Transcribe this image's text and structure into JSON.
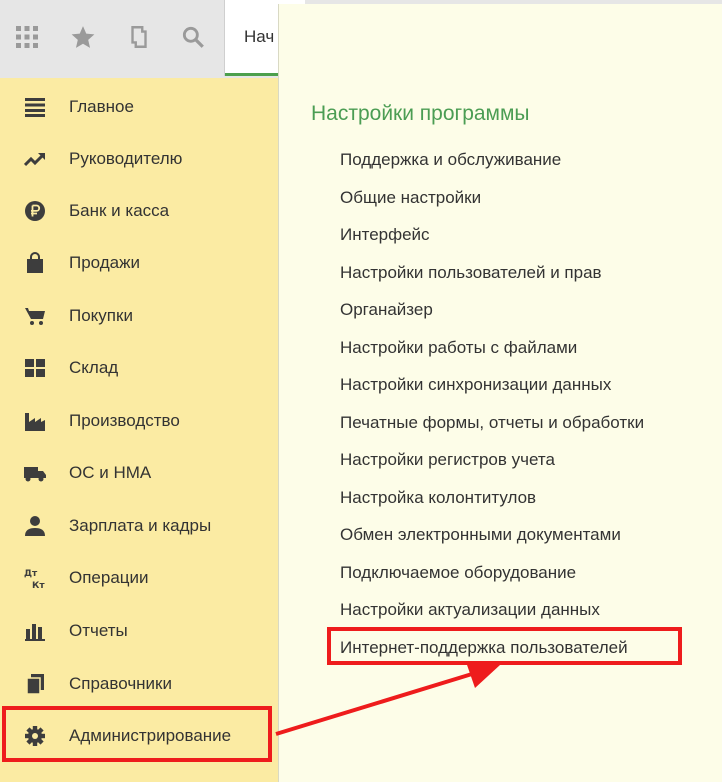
{
  "toolbar": {
    "icons": [
      "apps-grid-icon",
      "star-icon",
      "history-icon",
      "search-icon"
    ],
    "tab_label": "Нач"
  },
  "sidebar": {
    "items": [
      {
        "label": "Главное",
        "icon": "menu-lines-icon"
      },
      {
        "label": "Руководителю",
        "icon": "trend-icon"
      },
      {
        "label": "Банк и касса",
        "icon": "ruble-coin-icon"
      },
      {
        "label": "Продажи",
        "icon": "shopping-bag-icon"
      },
      {
        "label": "Покупки",
        "icon": "cart-icon"
      },
      {
        "label": "Склад",
        "icon": "warehouse-icon"
      },
      {
        "label": "Производство",
        "icon": "factory-icon"
      },
      {
        "label": "ОС и НМА",
        "icon": "truck-icon"
      },
      {
        "label": "Зарплата и кадры",
        "icon": "person-icon"
      },
      {
        "label": "Операции",
        "icon": "debit-credit-icon"
      },
      {
        "label": "Отчеты",
        "icon": "bar-chart-icon"
      },
      {
        "label": "Справочники",
        "icon": "books-icon"
      },
      {
        "label": "Администрирование",
        "icon": "gear-icon"
      }
    ]
  },
  "panel": {
    "title": "Настройки программы",
    "links": [
      "Поддержка и обслуживание",
      "Общие настройки",
      "Интерфейс",
      "Настройки пользователей и прав",
      "Органайзер",
      "Настройки работы с файлами",
      "Настройки синхронизации данных",
      "Печатные формы, отчеты и обработки",
      "Настройки регистров учета",
      "Настройка колонтитулов",
      "Обмен электронными документами",
      "Подключаемое оборудование",
      "Настройки актуализации данных",
      "Интернет-поддержка пользователей"
    ]
  },
  "colors": {
    "sidebar_bg": "#fbeba3",
    "panel_bg": "#fdfde8",
    "title_green": "#4b9d53",
    "annotation_red": "#ee1c1c"
  }
}
